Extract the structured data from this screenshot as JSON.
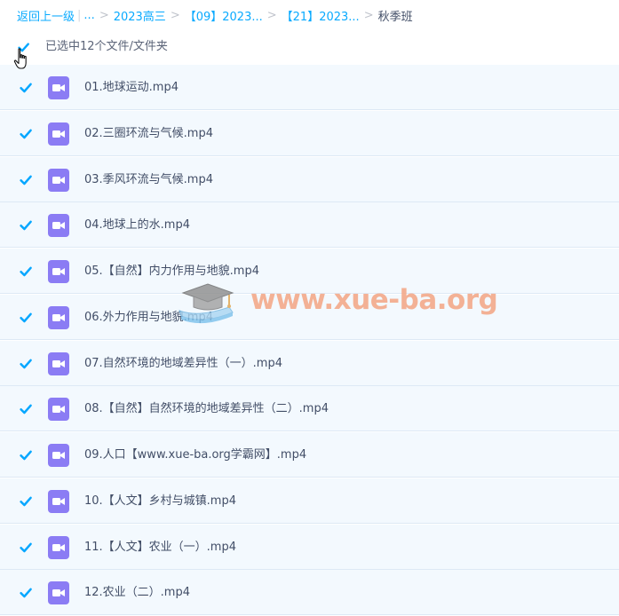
{
  "breadcrumb": {
    "back": "返回上一级",
    "ellipsis": "...",
    "crumbs": [
      "2023高三",
      "【09】2023...",
      "【21】2023..."
    ],
    "current": "秋季班"
  },
  "selection": {
    "label": "已选中12个文件/文件夹",
    "checked": true
  },
  "files": [
    {
      "name": "01.地球运动.mp4",
      "checked": true,
      "icon": "video-file-icon"
    },
    {
      "name": "02.三圈环流与气候.mp4",
      "checked": true,
      "icon": "video-file-icon"
    },
    {
      "name": "03.季风环流与气候.mp4",
      "checked": true,
      "icon": "video-file-icon"
    },
    {
      "name": "04.地球上的水.mp4",
      "checked": true,
      "icon": "video-file-icon"
    },
    {
      "name": "05.【自然】内力作用与地貌.mp4",
      "checked": true,
      "icon": "video-file-icon"
    },
    {
      "name": "06.外力作用与地貌.mp4",
      "checked": true,
      "icon": "video-file-icon"
    },
    {
      "name": "07.自然环境的地域差异性（一）.mp4",
      "checked": true,
      "icon": "video-file-icon"
    },
    {
      "name": "08.【自然】自然环境的地域差异性（二）.mp4",
      "checked": true,
      "icon": "video-file-icon"
    },
    {
      "name": "09.人口【www.xue-ba.org学霸网】.mp4",
      "checked": true,
      "icon": "video-file-icon"
    },
    {
      "name": "10.【人文】乡村与城镇.mp4",
      "checked": true,
      "icon": "video-file-icon"
    },
    {
      "name": "11.【人文】农业（一）.mp4",
      "checked": true,
      "icon": "video-file-icon"
    },
    {
      "name": "12.农业（二）.mp4",
      "checked": true,
      "icon": "video-file-icon"
    }
  ],
  "watermark": {
    "text": "www.xue-ba.org",
    "icon": "graduation-cap-book-icon"
  },
  "colors": {
    "accent": "#09aaff",
    "check": "#06a7ff",
    "video_icon": "#8b7cf4",
    "row_bg": "#f3f9fe",
    "watermark": "#f4a583"
  }
}
